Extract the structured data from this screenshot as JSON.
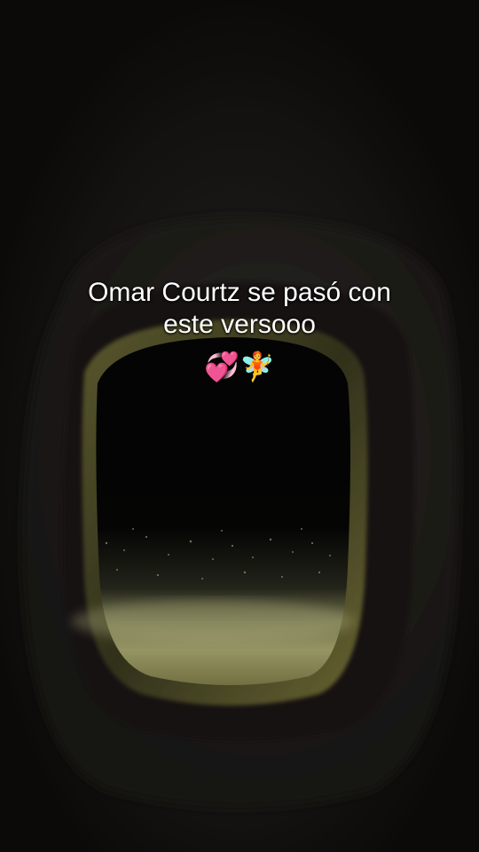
{
  "caption": {
    "line1": "Omar Courtz se pasó con",
    "line2": "este versooo",
    "emoji": "💞🧚"
  },
  "colors": {
    "background": "#0b0a0a",
    "window_frame": "#2a2724",
    "window_glow": "#c9c98a",
    "caption_text": "#ffffff"
  }
}
